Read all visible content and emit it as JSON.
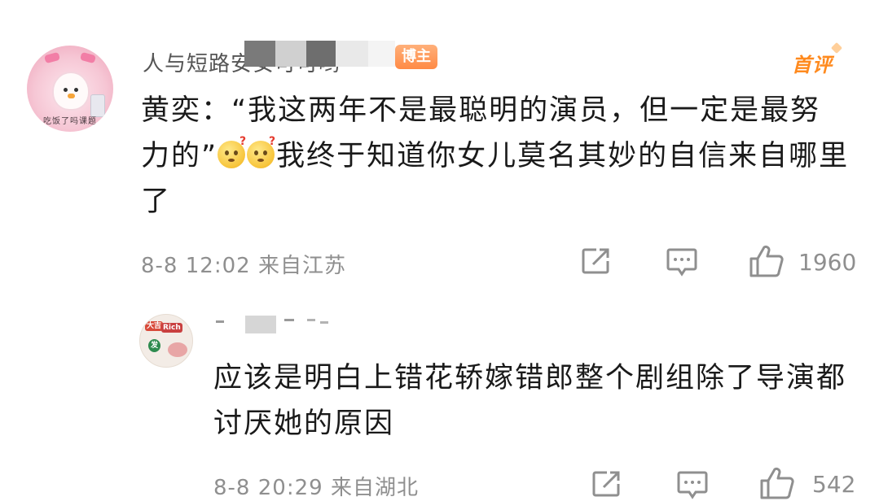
{
  "comment1": {
    "username": "人与短路安安可可哟",
    "badge": "博主",
    "first_label": "首评",
    "avatar_caption": "吃饭了吗课题",
    "text_before_emoji": "黄奕：“我这两年不是最聪明的演员，但一定是最努力的”",
    "emoji_icon": "confused-face-emoji",
    "text_after_emoji": "我终于知道你女儿莫名其妙的自信来自哪里了",
    "time": "8-8 12:02",
    "location": "来自江苏",
    "likes": "1960"
  },
  "comment2": {
    "avatar_tags": [
      "发",
      "Rich",
      "大吉"
    ],
    "text": "应该是明白上错花轿嫁错郎整个剧组除了导演都讨厌她的原因",
    "time": "8-8 20:29",
    "location": "来自湖北",
    "likes": "542"
  },
  "icons": {
    "share": "share-icon",
    "comment": "comment-icon",
    "like": "thumbs-up-icon"
  },
  "colors": {
    "accent_orange": "#ff8a1e",
    "meta_gray": "#8f8f8f",
    "text": "#1a1a1a"
  }
}
